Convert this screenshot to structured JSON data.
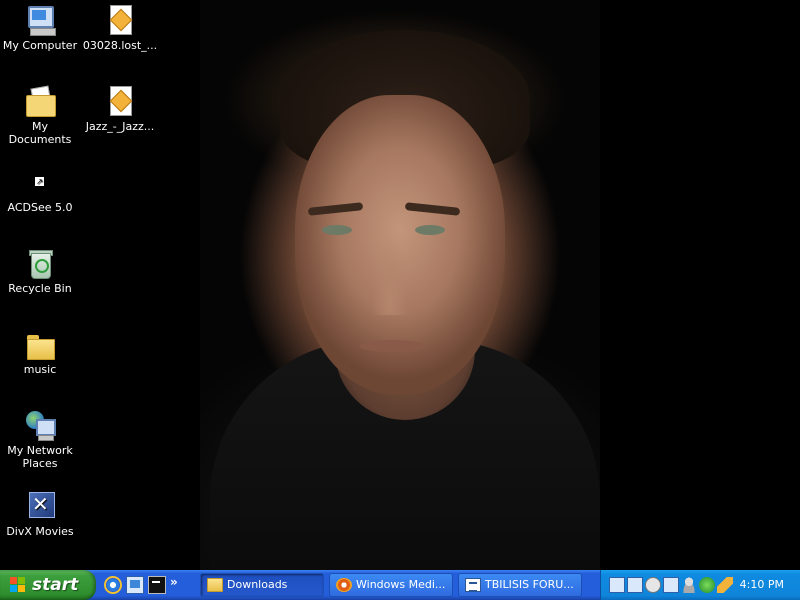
{
  "desktop": {
    "icons": [
      {
        "label": "My Computer",
        "icon": "my-computer-icon"
      },
      {
        "label": "03028.lost_...",
        "icon": "media-file-icon"
      },
      {
        "label": "My Documents",
        "icon": "my-documents-icon"
      },
      {
        "label": "Jazz_-_Jazz...",
        "icon": "media-file-icon"
      },
      {
        "label": "ACDSee 5.0",
        "icon": "shortcut-icon"
      },
      {
        "label": "Recycle Bin",
        "icon": "recycle-bin-icon"
      },
      {
        "label": "music",
        "icon": "folder-icon"
      },
      {
        "label": "My Network Places",
        "icon": "network-places-icon"
      },
      {
        "label": "DivX Movies",
        "icon": "divx-icon"
      }
    ]
  },
  "taskbar": {
    "start_label": "start",
    "quick_launch": [
      "internet-explorer-icon",
      "show-desktop-icon",
      "command-prompt-icon"
    ],
    "more_glyph": "»",
    "tasks": [
      {
        "label": "Downloads",
        "icon": "folder-icon",
        "active": true
      },
      {
        "label": "Windows Medi...",
        "icon": "windows-media-player-icon",
        "active": false
      },
      {
        "label": "TBILISIS FORU...",
        "icon": "document-icon",
        "active": false
      }
    ],
    "tray_icons": [
      "network-icon",
      "network-icon",
      "volume-icon",
      "display-icon",
      "user-icon",
      "update-icon",
      "pencil-icon"
    ],
    "clock": "4:10 PM"
  },
  "colors": {
    "taskbar": "#245edb",
    "start": "#3c9e3c",
    "tray": "#0f85da",
    "desktop": "#000000"
  }
}
